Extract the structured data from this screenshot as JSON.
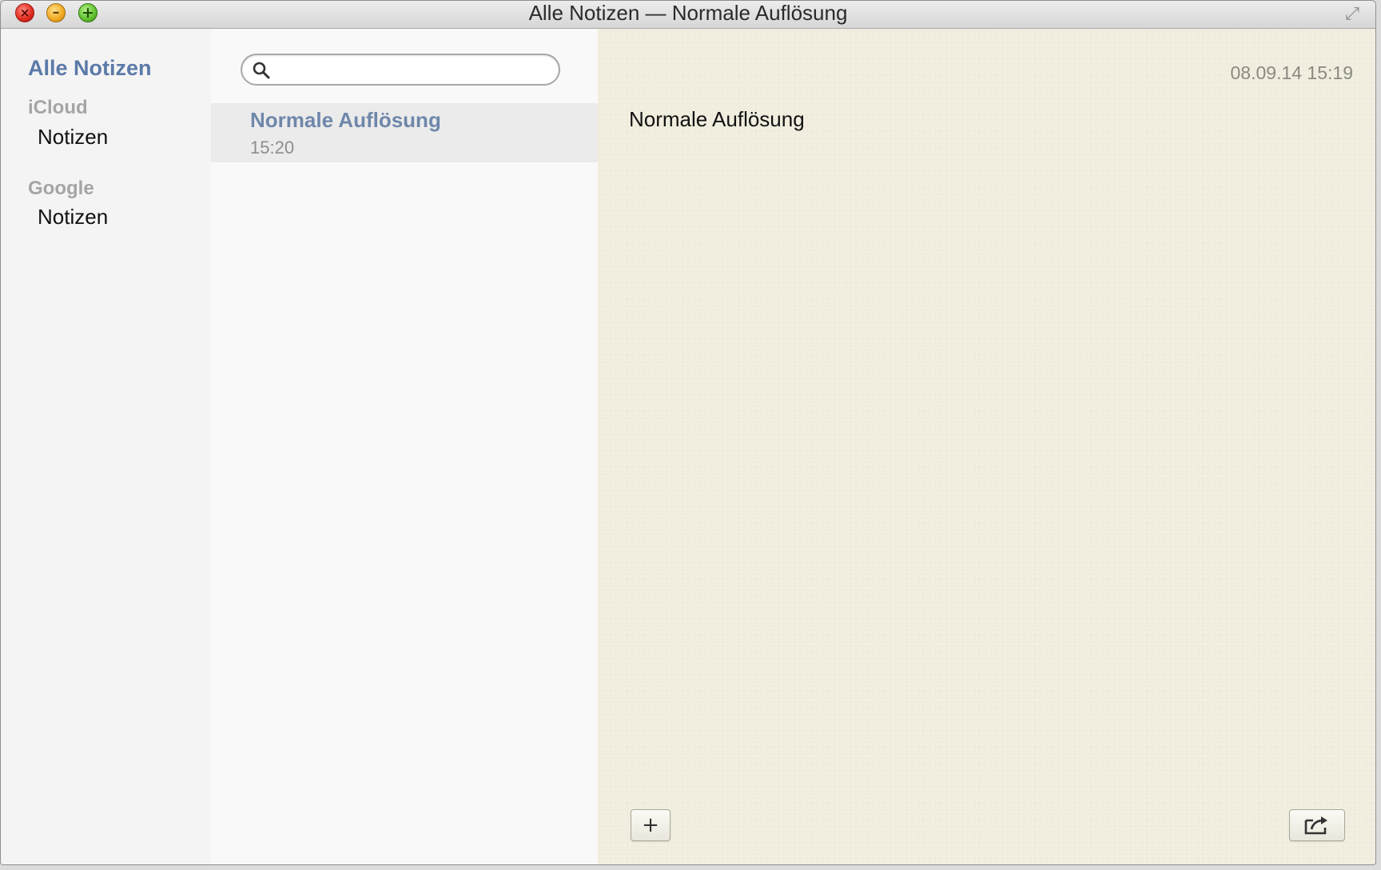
{
  "window": {
    "title": "Alle Notizen — Normale Auflösung",
    "close_glyph": "×",
    "minimize_glyph": "–",
    "zoom_glyph": "+",
    "fullscreen_glyph": "⤢"
  },
  "sidebar": {
    "all_notes_label": "Alle Notizen",
    "accounts": [
      {
        "name": "iCloud",
        "folders": [
          "Notizen"
        ]
      },
      {
        "name": "Google",
        "folders": [
          "Notizen"
        ]
      }
    ]
  },
  "search": {
    "value": "",
    "placeholder": ""
  },
  "notes": [
    {
      "title": "Normale Auflösung",
      "time": "15:20",
      "selected": true
    }
  ],
  "editor": {
    "date": "08.09.14 15:19",
    "body": "Normale Auflösung",
    "add_glyph": "+"
  },
  "colors": {
    "sidebar_accent": "#5b7aa8",
    "note_title": "#6f87aa",
    "paper": "#f1eedf"
  },
  "icons": {
    "search": "search-icon",
    "add": "plus-icon",
    "share": "share-icon"
  }
}
